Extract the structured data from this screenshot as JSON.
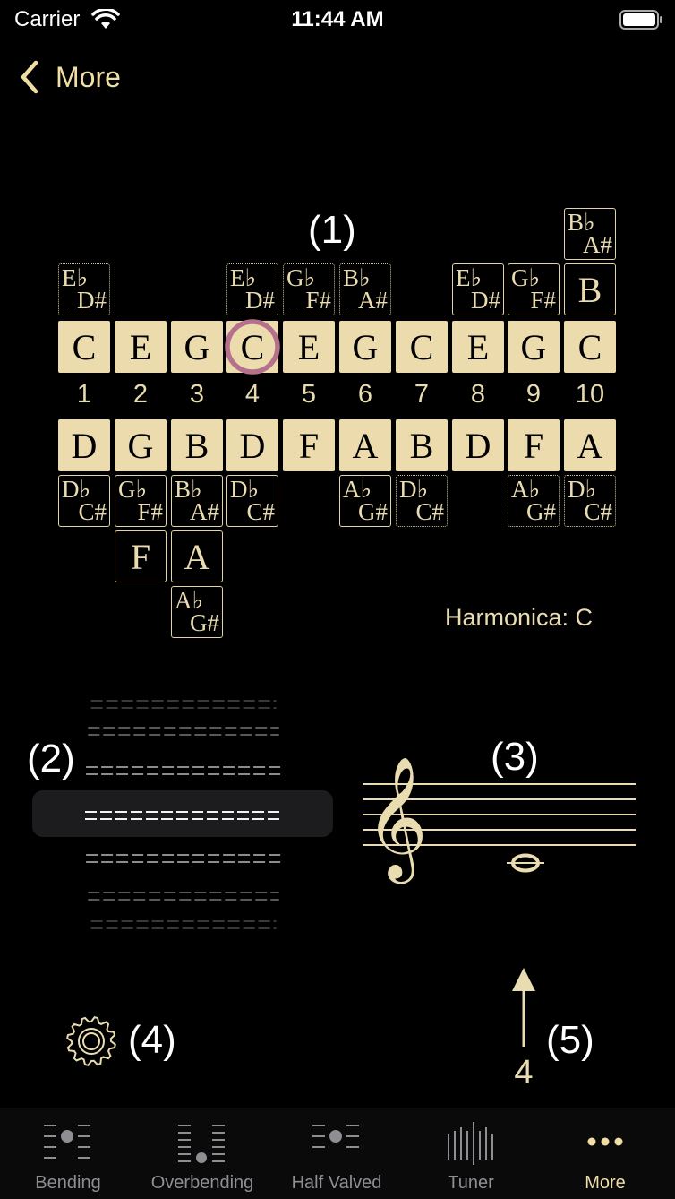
{
  "status_bar": {
    "carrier": "Carrier",
    "time": "11:44 AM"
  },
  "nav": {
    "back_label": "More"
  },
  "labels": {
    "l1": "(1)",
    "l2": "(2)",
    "l3": "(3)",
    "l4": "(4)",
    "l5": "(5)"
  },
  "harmonica_label": "Harmonica: C",
  "holes": [
    {
      "num": "1",
      "blow": "C",
      "draw": "D",
      "above": [
        {
          "t": "E♭",
          "b": "D#",
          "dotted": true
        }
      ],
      "below": [
        {
          "t": "D♭",
          "b": "C#"
        }
      ]
    },
    {
      "num": "2",
      "blow": "E",
      "draw": "G",
      "above": [],
      "below": [
        {
          "t": "G♭",
          "b": "F#"
        },
        {
          "single": "F"
        }
      ]
    },
    {
      "num": "3",
      "blow": "G",
      "draw": "B",
      "above": [],
      "below": [
        {
          "t": "B♭",
          "b": "A#"
        },
        {
          "single": "A"
        },
        {
          "t": "A♭",
          "b": "G#"
        }
      ]
    },
    {
      "num": "4",
      "blow": "C",
      "draw": "D",
      "above": [
        {
          "t": "E♭",
          "b": "D#",
          "dotted": true
        }
      ],
      "below": [
        {
          "t": "D♭",
          "b": "C#"
        }
      ]
    },
    {
      "num": "5",
      "blow": "E",
      "draw": "F",
      "above": [
        {
          "t": "G♭",
          "b": "F#",
          "dotted": true
        }
      ],
      "below": []
    },
    {
      "num": "6",
      "blow": "G",
      "draw": "A",
      "above": [
        {
          "t": "B♭",
          "b": "A#",
          "dotted": true
        }
      ],
      "below": [
        {
          "t": "A♭",
          "b": "G#"
        }
      ]
    },
    {
      "num": "7",
      "blow": "C",
      "draw": "B",
      "above": [],
      "below": [
        {
          "t": "D♭",
          "b": "C#",
          "dotted": true
        }
      ]
    },
    {
      "num": "8",
      "blow": "E",
      "draw": "D",
      "above": [
        {
          "t": "E♭",
          "b": "D#"
        }
      ],
      "below": []
    },
    {
      "num": "9",
      "blow": "G",
      "draw": "F",
      "above": [
        {
          "t": "G♭",
          "b": "F#"
        }
      ],
      "below": [
        {
          "t": "A♭",
          "b": "G#",
          "dotted": true
        }
      ]
    },
    {
      "num": "10",
      "blow": "C",
      "draw": "A",
      "above": [
        {
          "single": "B"
        },
        {
          "t": "B♭",
          "b": "A#"
        }
      ],
      "below": [
        {
          "t": "D♭",
          "b": "C#",
          "dotted": true
        }
      ]
    }
  ],
  "selected_hole": "4",
  "tuner": {
    "arrow_label": "4"
  },
  "tabs": [
    {
      "label": "Bending",
      "icon": "bending-icon"
    },
    {
      "label": "Overbending",
      "icon": "overbending-icon"
    },
    {
      "label": "Half Valved",
      "icon": "half-valved-icon"
    },
    {
      "label": "Tuner",
      "icon": "tuner-icon"
    },
    {
      "label": "More",
      "icon": "more-icon"
    }
  ],
  "colors": {
    "accent": "#efdfa5",
    "cell": "#ecdcad",
    "highlight": "#b5718b",
    "tab_inactive": "#8e8e93"
  }
}
